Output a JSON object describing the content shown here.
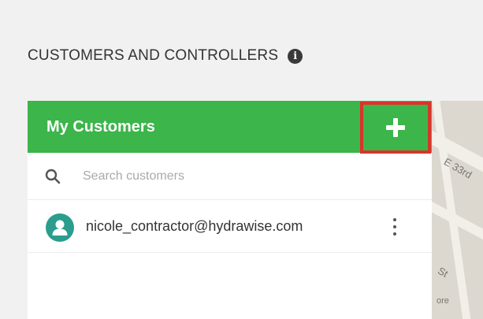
{
  "section": {
    "title": "CUSTOMERS AND CONTROLLERS",
    "info_icon": "i"
  },
  "panel": {
    "title": "My Customers",
    "header_color": "#3cb54a",
    "add_button_icon": "plus-icon",
    "highlight_color": "#d9342b"
  },
  "search": {
    "placeholder": "Search customers",
    "value": "",
    "icon": "search-icon"
  },
  "customers": [
    {
      "email": "nicole_contractor@hydrawise.com",
      "avatar_icon": "user-icon",
      "avatar_color": "#2a9d8f",
      "menu_icon": "more-vertical-icon"
    }
  ],
  "map": {
    "labels": [
      "E 33rd",
      "St",
      "ore"
    ]
  }
}
